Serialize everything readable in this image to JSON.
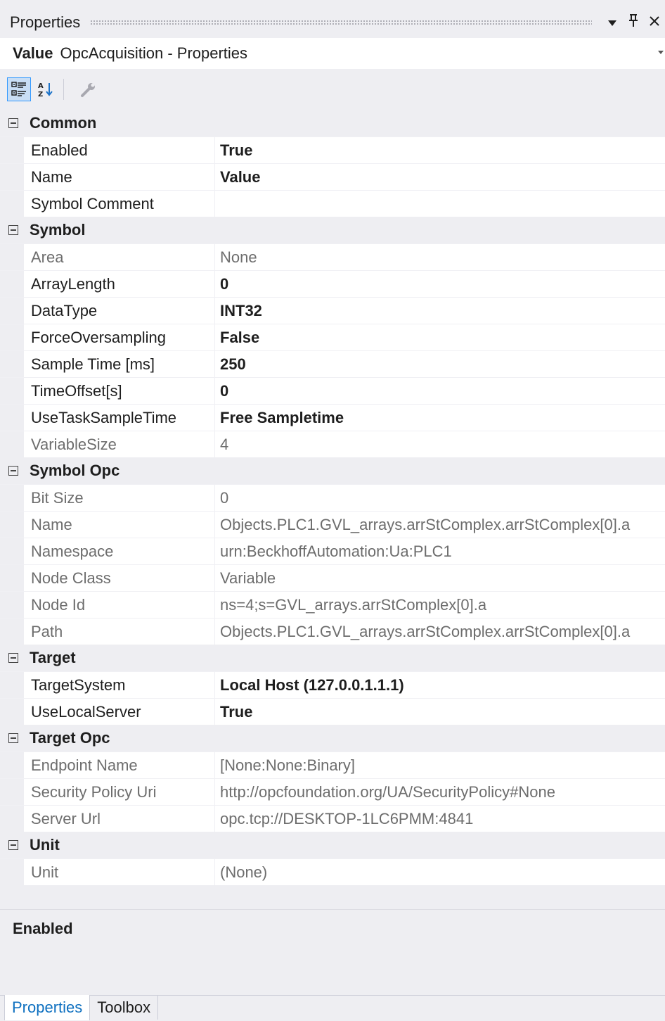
{
  "window": {
    "title": "Properties",
    "dropdown_glyph": "▼",
    "pin_glyph": "📌",
    "close_glyph": "✕"
  },
  "object": {
    "name": "Value",
    "type": "OpcAcquisition - Properties"
  },
  "categories": [
    {
      "name": "Common",
      "props": [
        {
          "label": "Enabled",
          "value": "True",
          "bold": true,
          "readonly": false
        },
        {
          "label": "Name",
          "value": "Value",
          "bold": true,
          "readonly": false
        },
        {
          "label": "Symbol Comment",
          "value": "",
          "bold": false,
          "readonly": false
        }
      ]
    },
    {
      "name": "Symbol",
      "props": [
        {
          "label": "Area",
          "value": "None",
          "bold": false,
          "readonly": true
        },
        {
          "label": "ArrayLength",
          "value": "0",
          "bold": true,
          "readonly": false
        },
        {
          "label": "DataType",
          "value": "INT32",
          "bold": true,
          "readonly": false
        },
        {
          "label": "ForceOversampling",
          "value": "False",
          "bold": true,
          "readonly": false
        },
        {
          "label": "Sample Time [ms]",
          "value": "250",
          "bold": true,
          "readonly": false
        },
        {
          "label": "TimeOffset[s]",
          "value": "0",
          "bold": true,
          "readonly": false
        },
        {
          "label": "UseTaskSampleTime",
          "value": "Free Sampletime",
          "bold": true,
          "readonly": false
        },
        {
          "label": "VariableSize",
          "value": "4",
          "bold": false,
          "readonly": true
        }
      ]
    },
    {
      "name": "Symbol Opc",
      "props": [
        {
          "label": "Bit Size",
          "value": "0",
          "bold": false,
          "readonly": true
        },
        {
          "label": "Name",
          "value": "Objects.PLC1.GVL_arrays.arrStComplex.arrStComplex[0].a",
          "bold": false,
          "readonly": true
        },
        {
          "label": "Namespace",
          "value": "urn:BeckhoffAutomation:Ua:PLC1",
          "bold": false,
          "readonly": true
        },
        {
          "label": "Node Class",
          "value": "Variable",
          "bold": false,
          "readonly": true
        },
        {
          "label": "Node Id",
          "value": "ns=4;s=GVL_arrays.arrStComplex[0].a",
          "bold": false,
          "readonly": true
        },
        {
          "label": "Path",
          "value": "Objects.PLC1.GVL_arrays.arrStComplex.arrStComplex[0].a",
          "bold": false,
          "readonly": true
        }
      ]
    },
    {
      "name": "Target",
      "props": [
        {
          "label": "TargetSystem",
          "value": "Local Host (127.0.0.1.1.1)",
          "bold": true,
          "readonly": false
        },
        {
          "label": "UseLocalServer",
          "value": "True",
          "bold": true,
          "readonly": false
        }
      ]
    },
    {
      "name": "Target Opc",
      "props": [
        {
          "label": "Endpoint Name",
          "value": " [None:None:Binary]",
          "bold": false,
          "readonly": true
        },
        {
          "label": "Security Policy Uri",
          "value": "http://opcfoundation.org/UA/SecurityPolicy#None",
          "bold": false,
          "readonly": true
        },
        {
          "label": "Server Url",
          "value": "opc.tcp://DESKTOP-1LC6PMM:4841",
          "bold": false,
          "readonly": true
        }
      ]
    },
    {
      "name": "Unit",
      "props": [
        {
          "label": "Unit",
          "value": "(None)",
          "bold": false,
          "readonly": true
        }
      ]
    }
  ],
  "description": {
    "title": "Enabled"
  },
  "tabs": [
    {
      "label": "Properties",
      "active": true
    },
    {
      "label": "Toolbox",
      "active": false
    }
  ],
  "toolbar": {
    "items": [
      "categorized-icon",
      "alphabetical-icon",
      "property-pages-icon"
    ]
  }
}
